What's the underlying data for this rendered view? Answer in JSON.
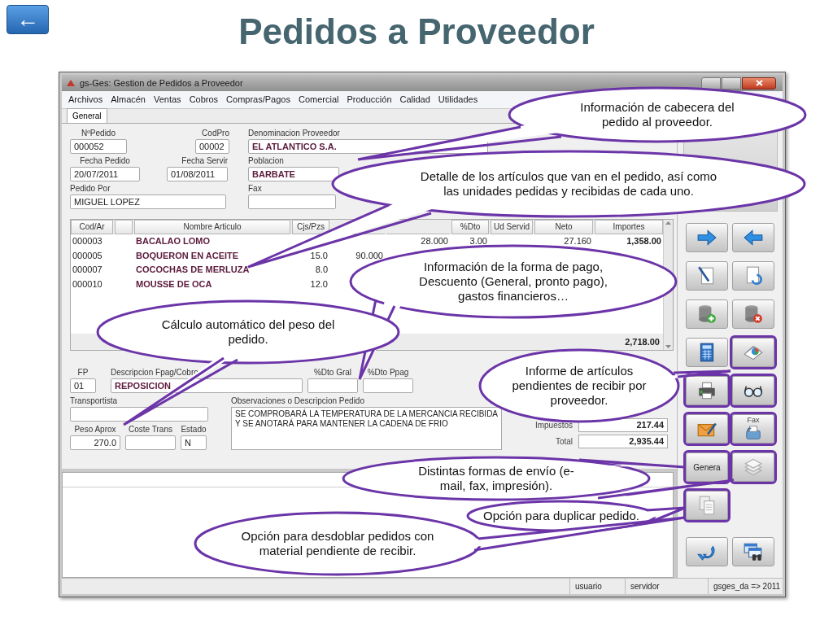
{
  "back_button": {
    "label": "←"
  },
  "title": "Pedidos a Proveedor",
  "window": {
    "title": "gs-Ges: Gestion de Pedidos a Proveedor"
  },
  "menu": [
    "Archivos",
    "Almacén",
    "Ventas",
    "Cobros",
    "Compras/Pagos",
    "Comercial",
    "Producción",
    "Calidad",
    "Utilidades"
  ],
  "tabs": [
    {
      "label": "General",
      "selected": true
    }
  ],
  "header_fields": [
    {
      "label": "NºPedido",
      "value": "000052",
      "kind": "plain"
    },
    {
      "label": "CodPro",
      "value": "00002",
      "kind": "plain"
    },
    {
      "label": "Denominacion Proveedor",
      "value": "EL ATLANTICO S.A.",
      "kind": "highlight"
    },
    {
      "label": "Fecha Pedido",
      "value": "20/07/2011",
      "kind": "plain"
    },
    {
      "label": "Fecha Servir",
      "value": "01/08/2011",
      "kind": "plain"
    },
    {
      "label": "Poblacion",
      "value": "BARBATE",
      "kind": "highlight"
    },
    {
      "label": "Pedido Por",
      "value": "MIGUEL LOPEZ",
      "kind": "plain"
    },
    {
      "label": "Fax",
      "kind": "plain"
    }
  ],
  "table": {
    "columns": [
      "Cod/Ar",
      null,
      "Nombre Articulo",
      "Cjs/Pzs",
      null,
      null,
      "%Dto",
      "Ud Servid",
      "Neto",
      "Importes"
    ],
    "rows": [
      [
        "000003",
        null,
        "BACALAO LOMO",
        null,
        null,
        "28.000",
        "3.00",
        null,
        "27.160",
        "1,358.00"
      ],
      [
        "000005",
        null,
        "BOQUERON EN ACEITE",
        "15.0",
        "90.000",
        null,
        null,
        null,
        null,
        null
      ],
      [
        "000007",
        null,
        "COCOCHAS DE MERLUZA",
        "8.0",
        null,
        null,
        null,
        null,
        null,
        null
      ],
      [
        "000010",
        null,
        "MOUSSE DE OCA",
        "12.0",
        null,
        null,
        null,
        null,
        null,
        null
      ]
    ],
    "total_importe": "2,718.00"
  },
  "payment_fields": [
    {
      "label": "FP",
      "value": "01",
      "kind": "plain"
    },
    {
      "label": "Descripcion Fpag/Cobro",
      "value": "REPOSICION",
      "kind": "highlight"
    },
    {
      "label": "%Dto Gral",
      "kind": "plain"
    },
    {
      "label": "%Dto Ppag",
      "kind": "plain"
    }
  ],
  "transport": {
    "label": "Transportista"
  },
  "weight_fields": [
    {
      "label": "Peso Aprox",
      "value": "270.0"
    },
    {
      "label": "Coste Trans"
    },
    {
      "label": "Estado",
      "value": "N"
    }
  ],
  "observaciones": {
    "label": "Observaciones o Descripcion Pedido",
    "lines": [
      "SE COMPROBARÁ LA TEMPERATURA DE LA MERCANCIA RECIBIDA",
      "Y SE ANOTARÁ PARA MANTENER LA CADENA DE FRIO"
    ]
  },
  "totals": [
    {
      "label": "Impuestos",
      "value": "217.44"
    },
    {
      "label": "Total",
      "value": "2,935.44"
    }
  ],
  "toolbar": [
    {
      "kind": "icon",
      "highlighted": false
    },
    {
      "kind": "icon",
      "highlighted": false
    },
    {
      "kind": "icon",
      "highlighted": false
    },
    {
      "kind": "icon",
      "highlighted": false
    },
    {
      "kind": "icon",
      "highlighted": false
    },
    {
      "kind": "icon",
      "highlighted": false
    },
    {
      "kind": "icon",
      "highlighted": false
    },
    {
      "kind": "icon",
      "highlighted": true
    },
    {
      "kind": "icon",
      "highlighted": true
    },
    {
      "kind": "icon",
      "highlighted": true
    },
    {
      "kind": "icon",
      "highlighted": true
    },
    {
      "kind": "icon",
      "label": "Fax",
      "highlighted": true
    },
    {
      "kind": "text",
      "label": "Genera",
      "highlighted": true
    },
    {
      "kind": "icon",
      "highlighted": true
    },
    {
      "kind": "icon",
      "highlighted": true
    },
    {
      "kind": "icon",
      "highlighted": false
    },
    {
      "kind": "icon",
      "highlighted": false
    }
  ],
  "status_bar": [
    "usuario",
    "servidor",
    "gsges_da => 2011"
  ],
  "callouts": [
    {
      "text": "Información de cabecera del pedido al proveedor."
    },
    {
      "text": "Detalle de los artículos que van en el pedido, así como las unidades pedidas y recibidas de cada uno."
    },
    {
      "text": "Información de la forma de pago, Descuento (General, pronto pago), gastos financieros…"
    },
    {
      "text": "Cálculo automático del peso del pedido."
    },
    {
      "text": "Informe de artículos pendientes de recibir por proveedor."
    },
    {
      "text": "Distintas formas de envío (e-mail, fax, impresión)."
    },
    {
      "text": "Opción para duplicar pedido."
    },
    {
      "text": "Opción para desdoblar pedidos con material pendiente de recibir."
    }
  ]
}
